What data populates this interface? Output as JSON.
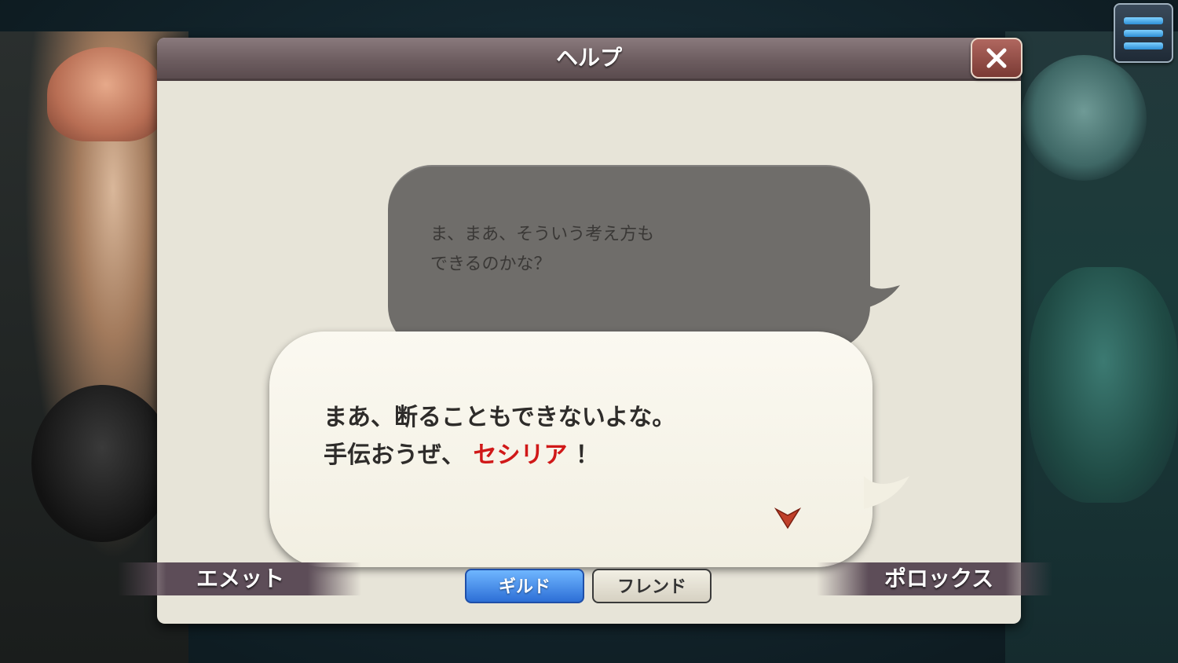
{
  "dialog": {
    "title": "ヘルプ"
  },
  "speech": {
    "back_line": "ま、まあ、そういう考え方も\nできるのかな？",
    "front_line1": "まあ、断ることもできないよな。",
    "front_line2_prefix": "手伝おうぜ、",
    "front_line2_highlight": "セシリア",
    "front_line2_suffix": "！"
  },
  "characters": {
    "left_name": "エメット",
    "right_name": "ポロックス"
  },
  "tabs": [
    {
      "label": "ギルド",
      "active": true
    },
    {
      "label": "フレンド",
      "active": false
    }
  ],
  "icons": {
    "menu": "hamburger-menu-icon",
    "close": "close-icon",
    "next": "next-arrow-icon"
  },
  "colors": {
    "highlight": "#d01818",
    "tab_active": "#2d6fd6"
  }
}
